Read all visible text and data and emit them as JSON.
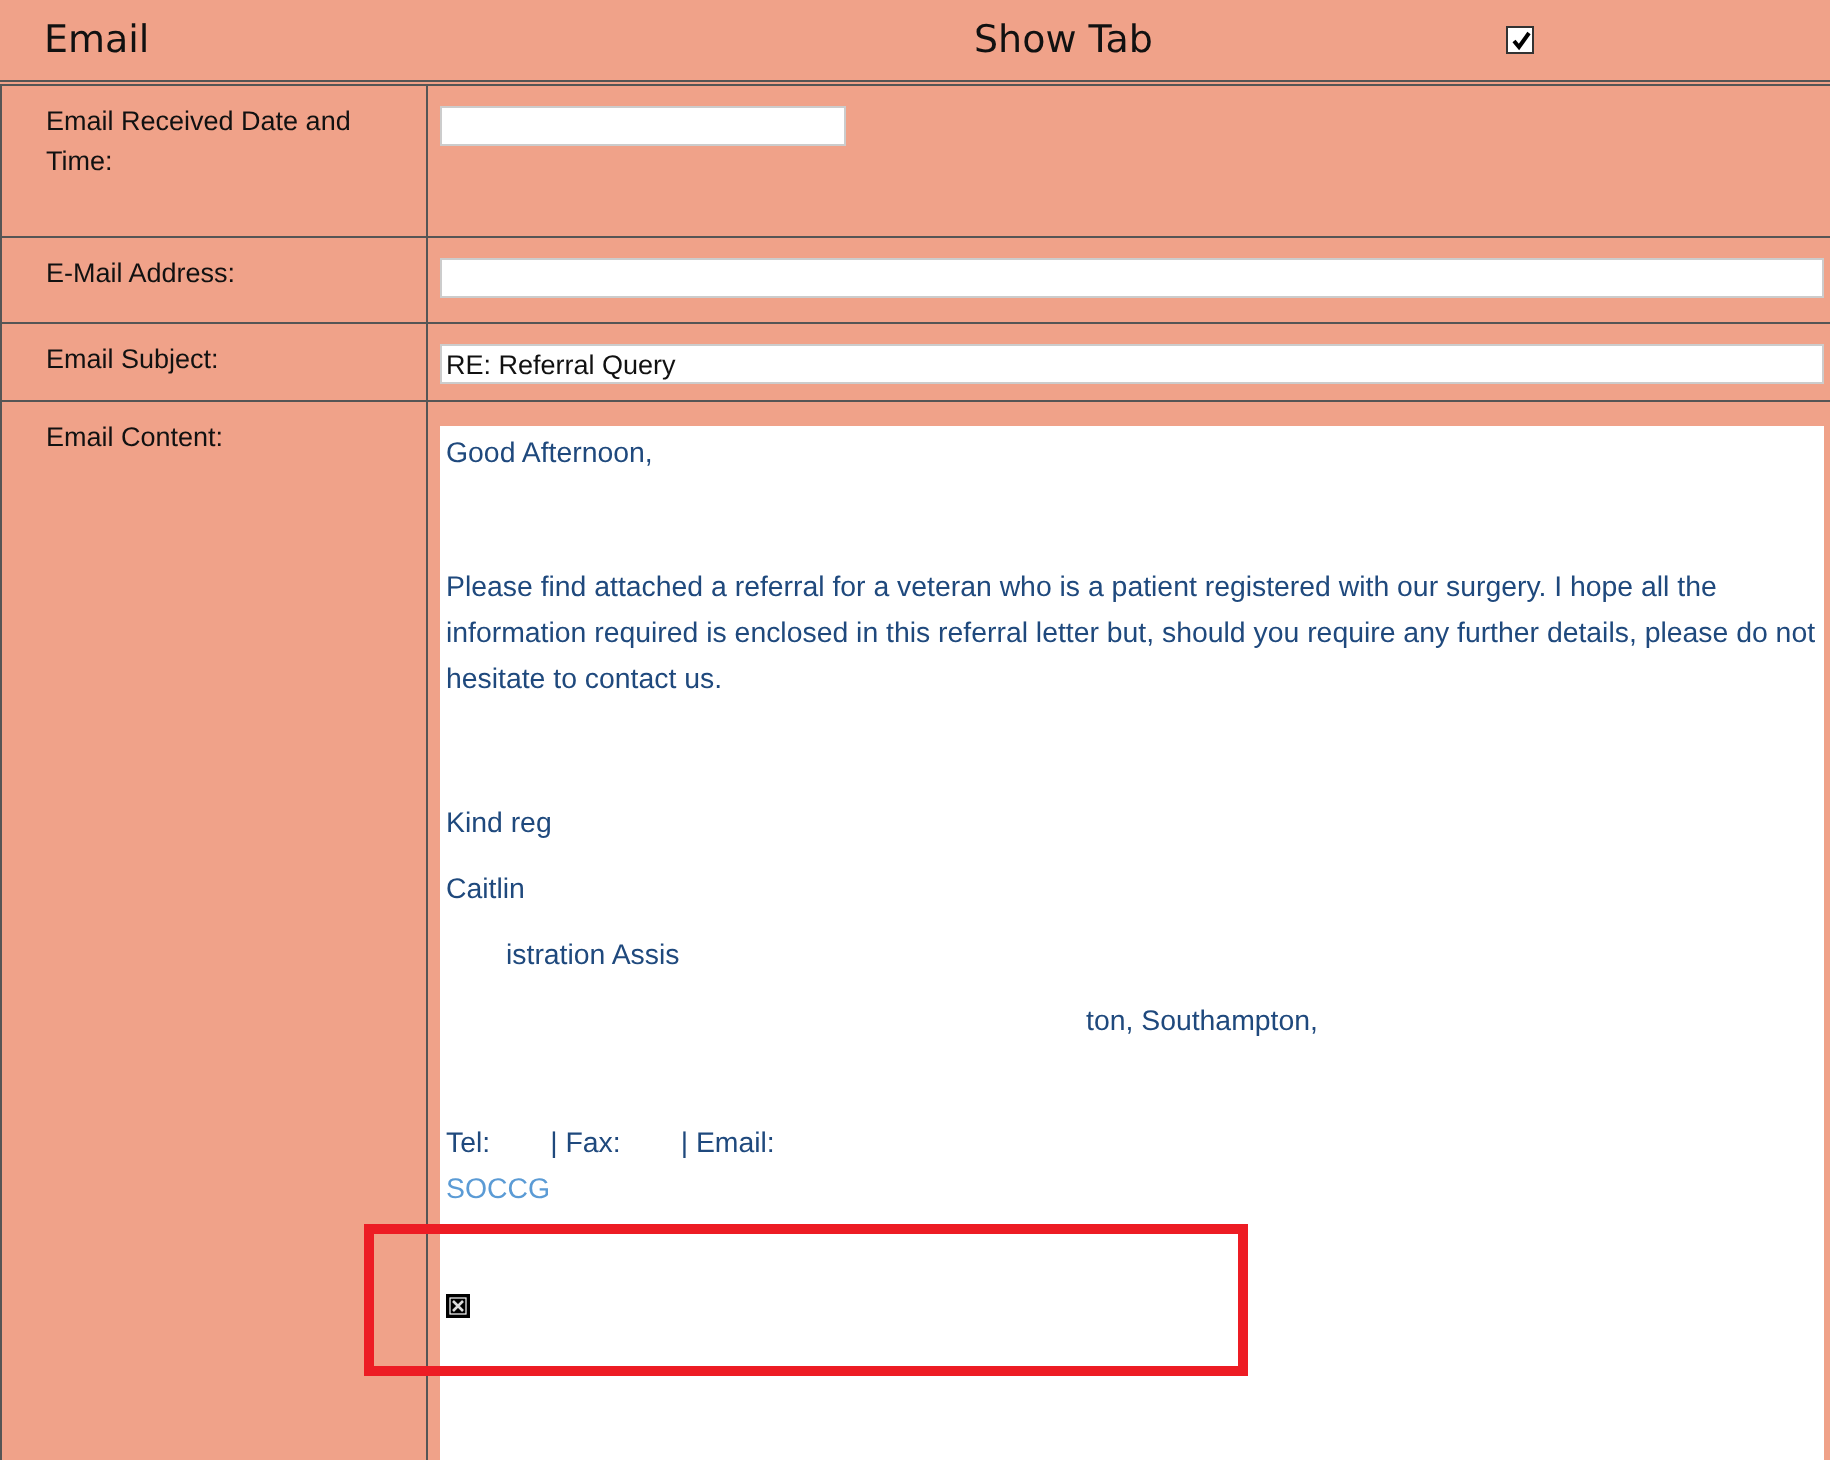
{
  "header": {
    "title": "Email",
    "toggle_label": "Show Tab",
    "checked": true
  },
  "fields": [
    {
      "label": "Email Received Date and Time:",
      "kind": "date"
    },
    {
      "label": "E-Mail Address:",
      "kind": "wide"
    },
    {
      "label": "Email Subject:",
      "kind": "wide",
      "value": "RE: Referral Query"
    },
    {
      "label": "Email Content:",
      "kind": "content"
    }
  ],
  "content_lines": [
    {
      "kind": "line",
      "segments": [
        {
          "kind": "text",
          "text": "Good Afternoon,"
        }
      ]
    },
    {
      "kind": "blank"
    },
    {
      "kind": "blank"
    },
    {
      "kind": "line",
      "segments": [
        {
          "kind": "text",
          "text": "Please find attached a referral for a veteran who is a patient registered with our surgery. I hope all the information required is enclosed in this referral letter but, should you require any further details, please do not hesitate to contact us."
        }
      ]
    },
    {
      "kind": "blank"
    },
    {
      "kind": "blank"
    },
    {
      "kind": "signature",
      "segments": [
        {
          "kind": "text",
          "text": "Kind reg"
        }
      ]
    },
    {
      "kind": "signature",
      "segments": [
        {
          "kind": "text",
          "text": "Caitlin"
        }
      ]
    },
    {
      "kind": "signature",
      "segments": [
        {
          "kind": "gap"
        },
        {
          "kind": "text",
          "text": "istration Assis"
        }
      ]
    },
    {
      "kind": "signature",
      "segments": [
        {
          "kind": "wide-gap"
        },
        {
          "kind": "text",
          "text": "ton, Southampton,"
        }
      ]
    },
    {
      "kind": "signature"
    },
    {
      "kind": "line",
      "segments": [
        {
          "kind": "text",
          "text": "Tel:"
        },
        {
          "kind": "gap"
        },
        {
          "kind": "text",
          "text": "| Fax:"
        },
        {
          "kind": "gap"
        },
        {
          "kind": "text",
          "text": "| Email:"
        }
      ]
    },
    {
      "kind": "line",
      "segments": [
        {
          "kind": "link",
          "text": "SOCCG"
        }
      ]
    },
    {
      "kind": "blank"
    },
    {
      "kind": "image"
    }
  ]
}
